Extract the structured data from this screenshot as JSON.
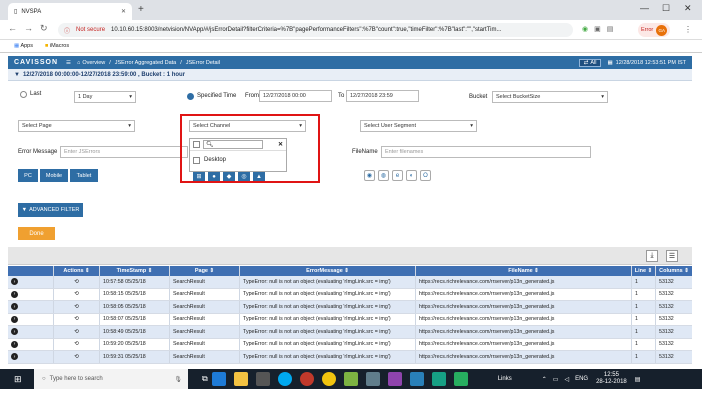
{
  "browser": {
    "tab_title": "NVSPA",
    "url_warning": "Not secure",
    "url": "10.10.60.15:8003/netvision/NVApp/#/jsErrorDetail?filterCriteria=%7B\"pagePerformanceFilters\":%7B\"count\":true,\"timeFilter\":%7B\"last\":\"\",\"startTim...",
    "bookmarks": [
      "Apps",
      "iMacros"
    ],
    "profile_label": "Error",
    "profile_initials": "GA"
  },
  "app": {
    "logo": "CAVISSON",
    "breadcrumb": [
      "Overview",
      "JSError Aggregated Data",
      "JSError Detail"
    ],
    "all_button": "All",
    "timestamp": "12/28/2018 12:53:51 PM IST"
  },
  "filter_summary": "12/27/2018 00:00:00-12/27/2018 23:59:00 , Bucket : 1 hour",
  "filters": {
    "last_label": "Last",
    "last_value": "1 Day",
    "specified_label": "Specified Time",
    "from_label": "From",
    "from_value": "12/27/2018 00:00",
    "to_label": "To",
    "to_value": "12/27/2018 23:59",
    "bucket_label": "Bucket",
    "bucket_value": "Select BucketSize",
    "page_value": "Select Page",
    "channel_value": "Select Channel",
    "segment_value": "Select User Segment",
    "error_message_label": "Error Message",
    "error_message_placeholder": "Enter JSErrors",
    "filename_label": "FileName",
    "filename_placeholder": "Enter filenames",
    "device_buttons": [
      "PC",
      "Mobile",
      "Tablet"
    ],
    "channel_options": [
      "Desktop"
    ],
    "advanced_filter": "ADVANCED FILTER",
    "done": "Done"
  },
  "table": {
    "columns": [
      "Actions",
      "TimeStamp",
      "Page",
      "ErrorMessage",
      "FileName",
      "Line",
      "Columns"
    ],
    "rows": [
      [
        "10:57:58 05/25/18",
        "SearchResult",
        "TypeError: null is not an object (evaluating 'rImgLink.src = img')",
        "https://recs.richrelevance.com/rrserver/p13n_generated.js",
        "1",
        "53132"
      ],
      [
        "10:58:15 05/25/18",
        "SearchResult",
        "TypeError: null is not an object (evaluating 'rImgLink.src = img')",
        "https://recs.richrelevance.com/rrserver/p13n_generated.js",
        "1",
        "53132"
      ],
      [
        "10:58:05 05/25/18",
        "SearchResult",
        "TypeError: null is not an object (evaluating 'rImgLink.src = img')",
        "https://recs.richrelevance.com/rrserver/p13n_generated.js",
        "1",
        "53132"
      ],
      [
        "10:58:07 05/25/18",
        "SearchResult",
        "TypeError: null is not an object (evaluating 'rImgLink.src = img')",
        "https://recs.richrelevance.com/rrserver/p13n_generated.js",
        "1",
        "53132"
      ],
      [
        "10:58:49 05/25/18",
        "SearchResult",
        "TypeError: null is not an object (evaluating 'rImgLink.src = img')",
        "https://recs.richrelevance.com/rrserver/p13n_generated.js",
        "1",
        "53132"
      ],
      [
        "10:59:20 05/25/18",
        "SearchResult",
        "TypeError: null is not an object (evaluating 'rImgLink.src = img')",
        "https://recs.richrelevance.com/rrserver/p13n_generated.js",
        "1",
        "53132"
      ],
      [
        "10:59:31 05/25/18",
        "SearchResult",
        "TypeError: null is not an object (evaluating 'rImgLink.src = img')",
        "https://recs.richrelevance.com/rrserver/p13n_generated.js",
        "1",
        "53132"
      ]
    ]
  },
  "taskbar": {
    "search_placeholder": "Type here to search",
    "links_label": "Links",
    "lang": "ENG",
    "time": "12:55",
    "date": "28-12-2018"
  },
  "colors": {
    "accent": "#2e6da4",
    "highlight_box": "#e01414",
    "done": "#f0a030"
  }
}
